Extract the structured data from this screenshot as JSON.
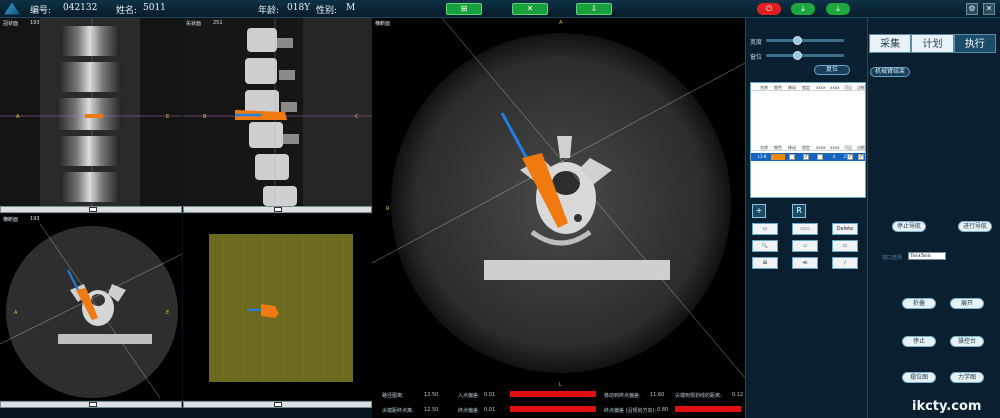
{
  "header": {
    "id_label": "编号:",
    "id_value": "042132",
    "name_label": "姓名:",
    "name_value": "5011",
    "age_label": "年龄:",
    "age_value": "018Y",
    "sex_label": "性别:",
    "sex_value": "M",
    "center_buttons": [
      "⊞",
      "✕",
      "⇩"
    ],
    "right_buttons": [
      "⏻",
      "⤓",
      "⤓"
    ]
  },
  "viewports": {
    "top_left": {
      "label": "冠状面",
      "num": "193"
    },
    "top_mid": {
      "label": "矢状面",
      "num": "251"
    },
    "main": {
      "label": "横断面",
      "num": ""
    },
    "bottom_left": {
      "label": "横断面",
      "num": "193"
    },
    "markers": {
      "a": "A",
      "b": "B",
      "c": "C",
      "d": "D",
      "e": "E",
      "r": "R",
      "l": "L"
    }
  },
  "readout": {
    "row1": [
      {
        "label": "路径图离:",
        "value": "12.50"
      },
      {
        "label": "入点偏差:",
        "value": "0.01"
      },
      {
        "label": "移动到终点偏差:",
        "value": "11.60"
      },
      {
        "label": "尖端到规划线的距离:",
        "value": "0.12"
      }
    ],
    "row2": [
      {
        "label": "尖端距终点离:",
        "value": "12.50"
      },
      {
        "label": "终点偏差:",
        "value": "0.01"
      },
      {
        "label": "终点偏差 (沿规划方向):",
        "value": "0.80"
      }
    ]
  },
  "left_panel": {
    "slider1_label": "宽度",
    "slider2_label": "窗位",
    "slider1_level": 0.4,
    "slider2_level": 0.4,
    "reset_label": "复位",
    "table_headers": [
      "名称",
      "颜色",
      "移动",
      "锁定",
      "xxxx",
      "xxxx",
      "可见",
      "边框"
    ],
    "row_headers": [
      "名称",
      "颜色",
      "移动",
      "锁定",
      "xxxx",
      "xxxx",
      "可见",
      "边框"
    ],
    "row": {
      "name": "L1-8",
      "color": "#f08a10",
      "v1": "4",
      "v2": "21"
    },
    "tool_R": "R",
    "tool_plus": "+",
    "tools": [
      "▭",
      "▭▭",
      "Delete",
      "🔍",
      "▱",
      "▭",
      "⊞",
      "≪",
      "∕"
    ]
  },
  "right_panel": {
    "tabs": [
      "采集",
      "计划",
      "执行"
    ],
    "active_tab": 2,
    "arm_label": "机械臂结束",
    "stop_nav": "停止导航",
    "start_nav": "进行导航",
    "port_label": "端口选择",
    "port_value": "ThinkTools",
    "buttons": [
      "折叠",
      "展开",
      "停止",
      "操控台",
      "摆位图",
      "力学图"
    ]
  },
  "watermark": "ikcty.com"
}
